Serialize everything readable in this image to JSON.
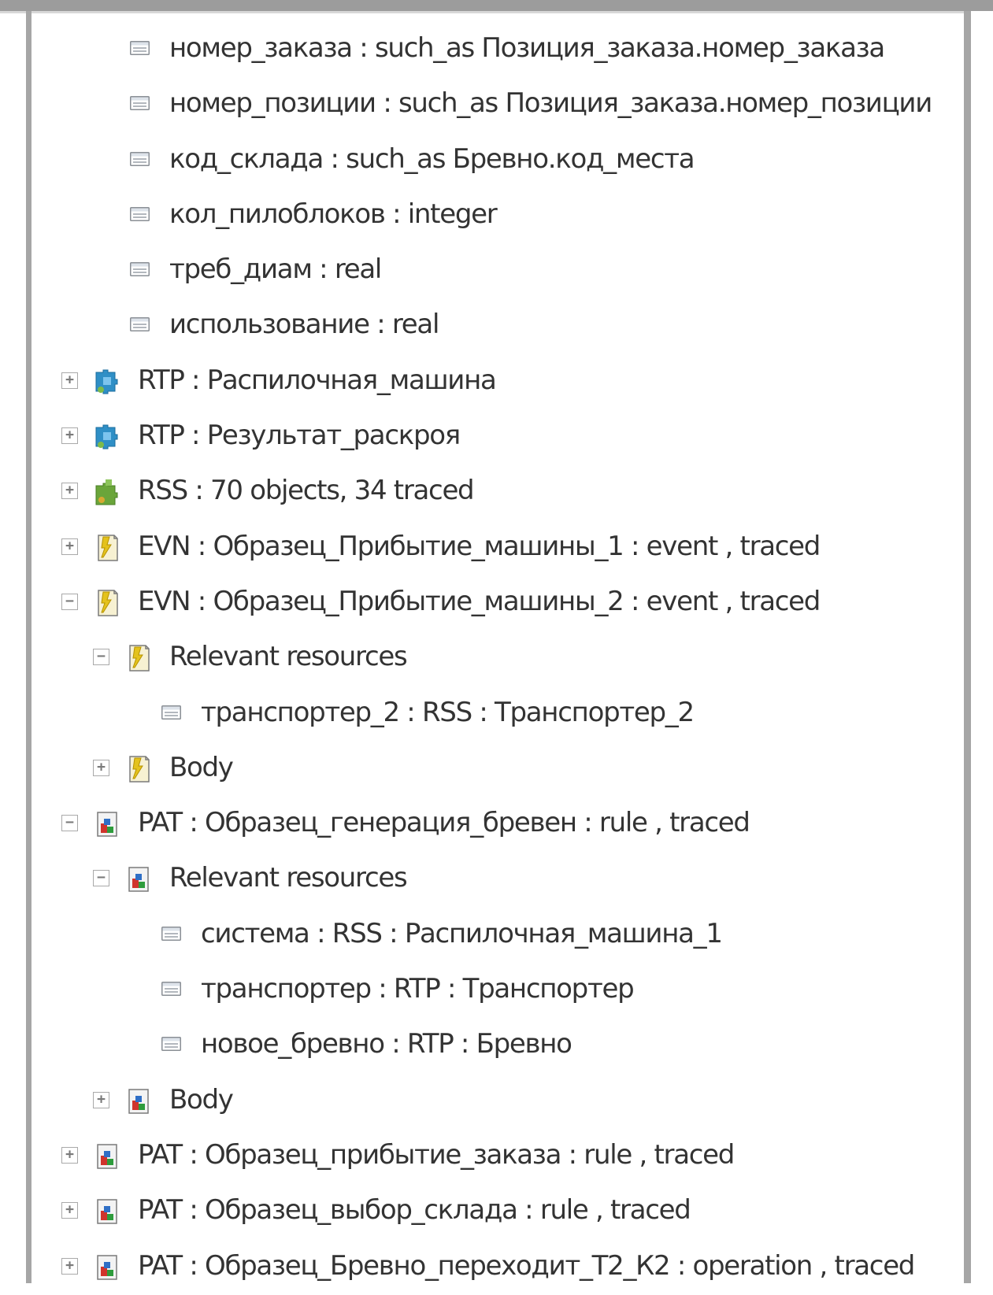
{
  "tree": {
    "rows": [
      {
        "label": "номер_заказа : such_as Позиция_заказа.номер_заказа"
      },
      {
        "label": "номер_позиции : such_as Позиция_заказа.номер_позиции"
      },
      {
        "label": "код_склада : such_as Бревно.код_места"
      },
      {
        "label": "кол_пилоблоков : integer"
      },
      {
        "label": "треб_диам : real"
      },
      {
        "label": "использование : real"
      },
      {
        "label": "RTP : Распилочная_машина",
        "expander": "+"
      },
      {
        "label": "RTP : Результат_раскроя",
        "expander": "+"
      },
      {
        "label": "RSS : 70 objects, 34 traced",
        "expander": "+"
      },
      {
        "label": "EVN : Образец_Прибытие_машины_1 : event , traced",
        "expander": "+"
      },
      {
        "label": "EVN : Образец_Прибытие_машины_2 : event , traced",
        "expander": "−"
      },
      {
        "label": "Relevant resources",
        "expander": "−"
      },
      {
        "label": "транспортер_2 : RSS : Транспортер_2"
      },
      {
        "label": "Body",
        "expander": "+"
      },
      {
        "label": "PAT : Образец_генерация_бревен : rule , traced",
        "expander": "−"
      },
      {
        "label": "Relevant resources",
        "expander": "−"
      },
      {
        "label": "система : RSS : Распилочная_машина_1"
      },
      {
        "label": "транспортер : RTP : Транспортер"
      },
      {
        "label": "новое_бревно : RTP : Бревно"
      },
      {
        "label": "Body",
        "expander": "+"
      },
      {
        "label": "PAT : Образец_прибытие_заказа : rule , traced",
        "expander": "+"
      },
      {
        "label": "PAT : Образец_выбор_склада : rule , traced",
        "expander": "+"
      },
      {
        "label": "PAT : Образец_Бревно_переходит_Т2_К2 : operation , traced",
        "expander": "+"
      }
    ]
  },
  "icons": {
    "field": "field-icon",
    "rtp": "resource-type-puzzle-icon",
    "rss": "resources-puzzle-icon",
    "evn": "event-icon",
    "pat": "pattern-icon"
  },
  "colors": {
    "text": "#333333",
    "frame": "#a6a6a6",
    "rtp_icon": "#2f8fc6",
    "rss_icon": "#6aa53a",
    "evn_icon": "#e4c21c"
  }
}
